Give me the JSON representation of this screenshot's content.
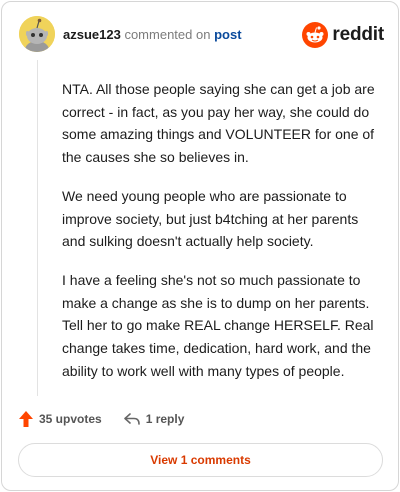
{
  "comment": {
    "username": "azsue123",
    "action_text": "commented on",
    "post_link": "post",
    "paragraphs": [
      "NTA. All those people saying she can get a job are correct - in fact, as you pay her way, she could do some amazing things and VOLUNTEER for one of the causes she so believes in.",
      "We need young people who are passionate to improve society, but just b4tching at her parents and sulking doesn't actually help society.",
      "I have a feeling she's not so much passionate to make a change as she is to dump on her parents. Tell her to go make REAL change HERSELF. Real change takes time, dedication, hard work, and the ability to work well with many types of people."
    ]
  },
  "brand": {
    "name": "reddit",
    "color": "#ff4500"
  },
  "actions": {
    "upvotes": "35 upvotes",
    "replies": "1 reply"
  },
  "view_comments_label": "View 1 comments",
  "icons": [
    "avatar",
    "reddit-logo-icon",
    "upvote-arrow-icon",
    "reply-arrow-icon"
  ]
}
